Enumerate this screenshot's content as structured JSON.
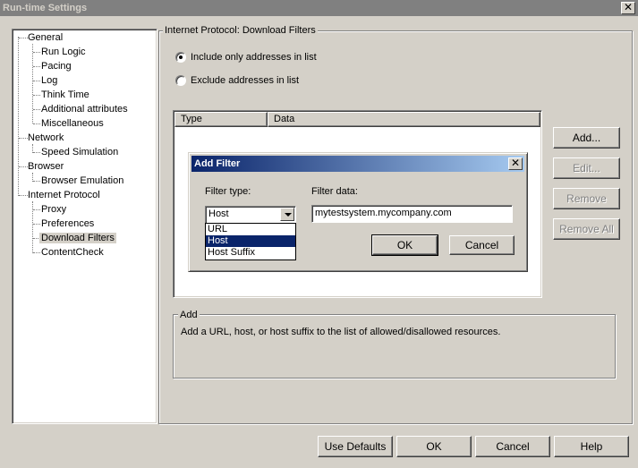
{
  "window": {
    "title": "Run-time Settings",
    "close_glyph": "✕"
  },
  "tree": {
    "items": [
      {
        "label": "General",
        "level": 0
      },
      {
        "label": "Run Logic",
        "level": 1
      },
      {
        "label": "Pacing",
        "level": 1
      },
      {
        "label": "Log",
        "level": 1
      },
      {
        "label": "Think Time",
        "level": 1
      },
      {
        "label": "Additional attributes",
        "level": 1
      },
      {
        "label": "Miscellaneous",
        "level": 1
      },
      {
        "label": "Network",
        "level": 0
      },
      {
        "label": "Speed Simulation",
        "level": 1
      },
      {
        "label": "Browser",
        "level": 0
      },
      {
        "label": "Browser Emulation",
        "level": 1
      },
      {
        "label": "Internet Protocol",
        "level": 0
      },
      {
        "label": "Proxy",
        "level": 1
      },
      {
        "label": "Preferences",
        "level": 1
      },
      {
        "label": "Download Filters",
        "level": 1,
        "selected": true
      },
      {
        "label": "ContentCheck",
        "level": 1
      }
    ]
  },
  "panel": {
    "title": "Internet Protocol: Download Filters",
    "radio_include": "Include only addresses in list",
    "radio_exclude": "Exclude addresses in list",
    "selected_radio": "include",
    "list_columns": [
      "Type",
      "Data"
    ],
    "buttons": {
      "add": "Add...",
      "edit": "Edit...",
      "remove": "Remove",
      "remove_all": "Remove All"
    },
    "desc_title": "Add",
    "desc_text": "Add a URL, host, or host suffix to the list of allowed/disallowed resources."
  },
  "dialog": {
    "title": "Add Filter",
    "close_glyph": "✕",
    "filter_type_label": "Filter type:",
    "filter_type_value": "Host",
    "filter_type_options": [
      "URL",
      "Host",
      "Host Suffix"
    ],
    "filter_type_selected": "Host",
    "filter_data_label": "Filter data:",
    "filter_data_value": "mytestsystem.mycompany.com",
    "ok": "OK",
    "cancel": "Cancel"
  },
  "footer": {
    "use_defaults": "Use Defaults",
    "ok": "OK",
    "cancel": "Cancel",
    "help": "Help"
  },
  "colors": {
    "face": "#d4d0c8",
    "selection": "#0a246a",
    "dialog_title_gradient_end": "#a6caf0"
  }
}
